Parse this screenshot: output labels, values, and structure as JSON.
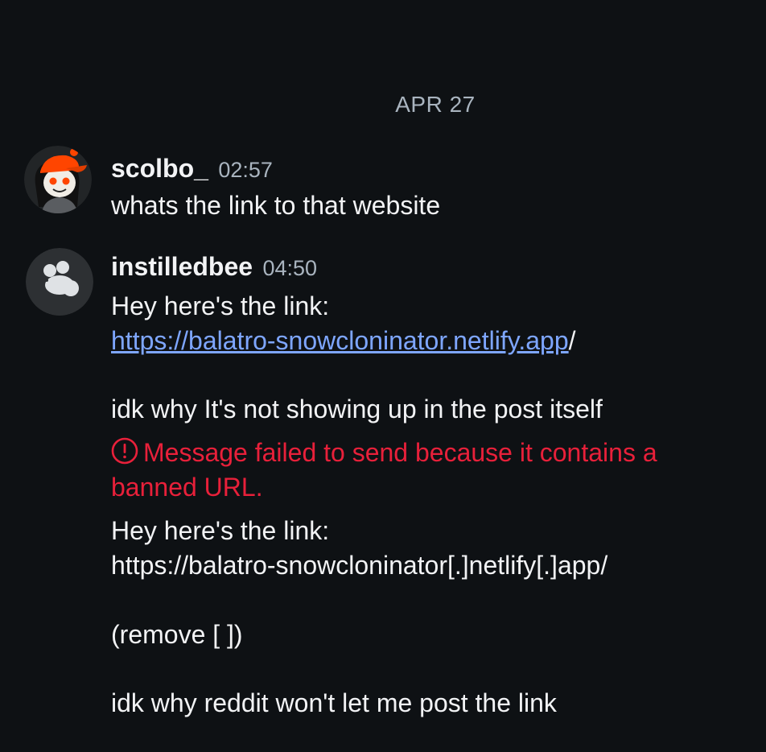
{
  "date_divider": "APR 27",
  "messages": [
    {
      "username": "scolbo_",
      "time": "02:57",
      "avatar": "reddit-snoo-orange-cap-avatar",
      "lines": [
        "whats the link to that website"
      ]
    },
    {
      "username": "instilledbee",
      "time": "04:50",
      "avatar": "mouse-avatar",
      "line1": "Hey here's the link:",
      "link": "https://balatro-snowcloninator.netlify.app",
      "link_suffix": "/",
      "line3": "idk why It's not showing up in the post itself"
    }
  ],
  "error": {
    "icon": "alert-circle-icon",
    "line1": "Message failed to send because it contains a",
    "line2": "banned URL.",
    "color": "#e8203a"
  },
  "followup": {
    "line1": "Hey here's the link:",
    "line2": "https://balatro-snowcloninator[.]netlify[.]app/",
    "line3": "(remove [ ])",
    "line4": "idk why reddit won't let me post the link"
  },
  "colors": {
    "background": "#0e1114",
    "text": "#f2f3f5",
    "muted": "#a9b4bf",
    "link": "#7ea6ff",
    "error": "#e8203a"
  }
}
